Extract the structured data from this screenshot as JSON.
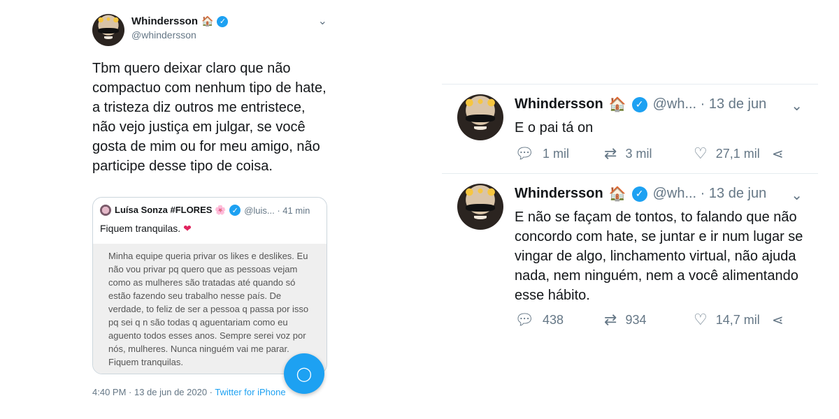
{
  "left_tweet": {
    "author": "Whindersson",
    "handle": "@whindersson",
    "text": "Tbm quero deixar claro que não compactuo com nenhum tipo de hate, a tristeza diz outros me entristece, não vejo justiça em julgar, se você gosta de mim ou for meu amigo, não participe desse tipo de coisa.",
    "quote": {
      "author": "Luísa Sonza #FLORES 🌸",
      "meta": "@luis... · 41 min",
      "text": "Fiquem tranquilas.",
      "image_text": "Minha equipe queria privar os likes e deslikes. Eu não vou privar pq quero que as pessoas vejam como as mulheres são tratadas até quando só estão fazendo seu trabalho nesse país. De verdade, to feliz de ser a pessoa q passa por isso pq sei q n são todas q aguentariam como eu aguento todos esses anos. Sempre serei voz por nós, mulheres. Nunca ninguém vai me parar. Fiquem tranquilas."
    },
    "timestamp": "4:40 PM · 13 de jun de 2020 · ",
    "source": "Twitter for iPhone"
  },
  "right_tweets": [
    {
      "author": "Whindersson",
      "meta": "@wh... · 13 de jun",
      "text": "E o pai tá on",
      "replies": "1 mil",
      "retweets": "3 mil",
      "likes": "27,1 mil"
    },
    {
      "author": "Whindersson",
      "meta": "@wh... · 13 de jun",
      "text": "E não se façam de tontos, to falando que não concordo com hate, se juntar e ir num lugar se vingar de algo, linchamento virtual, não ajuda nada, nem ninguém, nem a você alimentando esse hábito.",
      "replies": "438",
      "retweets": "934",
      "likes": "14,7 mil"
    }
  ],
  "colors": {
    "accent": "#1da1f2",
    "secondary_text": "#657786",
    "like_heart": "#e0245e"
  },
  "icons": [
    "verified-badge-icon",
    "house-emoji-icon",
    "chevron-down-icon",
    "reply-icon",
    "retweet-icon",
    "like-icon",
    "share-icon",
    "compose-fab-icon"
  ]
}
